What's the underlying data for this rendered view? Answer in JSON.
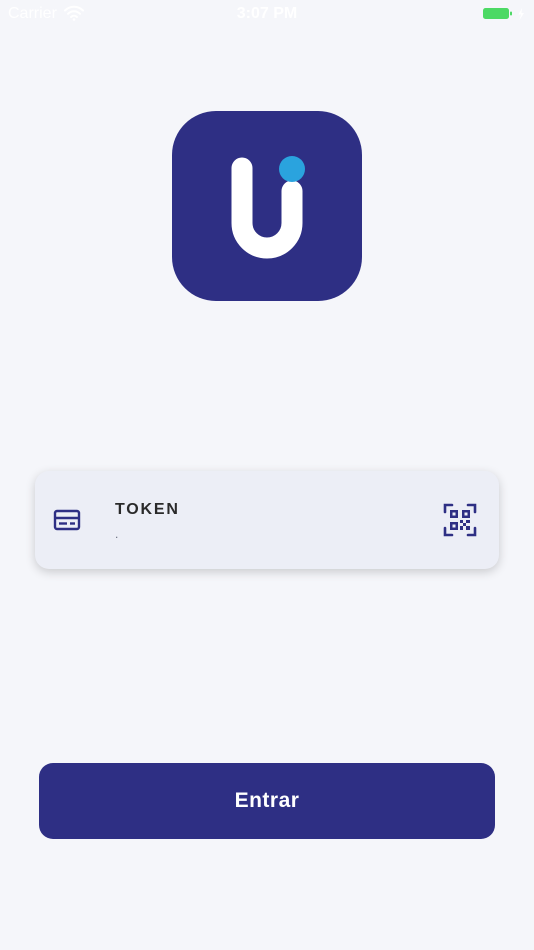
{
  "status_bar": {
    "carrier": "Carrier",
    "time": "3:07 PM",
    "wifi_icon": "wifi-icon",
    "battery_icon": "battery-charging-icon",
    "battery_color": "#4cd964"
  },
  "logo": {
    "icon": "app-logo-icon",
    "background_color": "#2e2f84",
    "dot_color": "#2aa3de"
  },
  "token_field": {
    "label": "TOKEN",
    "value": ".",
    "left_icon": "id-card-icon",
    "right_icon": "qr-code-icon"
  },
  "primary_button": {
    "label": "Entrar",
    "color": "#2e2f84"
  }
}
